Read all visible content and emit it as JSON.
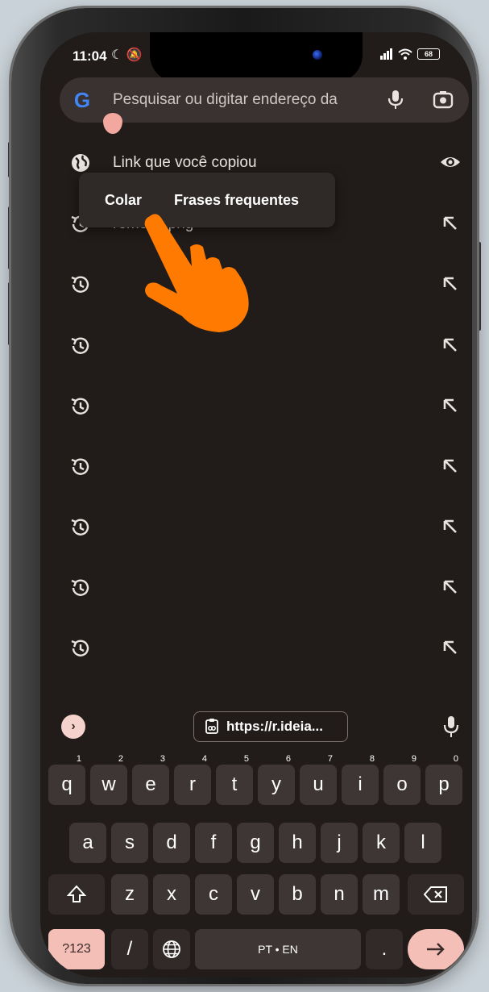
{
  "status_bar": {
    "time": "11:04",
    "battery": "68"
  },
  "search": {
    "placeholder": "Pesquisar ou digitar endereço da"
  },
  "suggestions": [
    {
      "label": "Link que você copiou",
      "type": "clipboard"
    },
    {
      "label": "remove.png",
      "type": "history"
    },
    {
      "label": "",
      "type": "history"
    },
    {
      "label": "",
      "type": "history"
    },
    {
      "label": "",
      "type": "history"
    },
    {
      "label": "",
      "type": "history"
    },
    {
      "label": "",
      "type": "history"
    },
    {
      "label": "",
      "type": "history"
    },
    {
      "label": "",
      "type": "history"
    }
  ],
  "context_menu": {
    "paste": "Colar",
    "frequent": "Frases frequentes"
  },
  "keyboard": {
    "clipboard_chip": "https://r.ideia...",
    "row1": [
      "q",
      "w",
      "e",
      "r",
      "t",
      "y",
      "u",
      "i",
      "o",
      "p"
    ],
    "row1_hints": [
      "1",
      "2",
      "3",
      "4",
      "5",
      "6",
      "7",
      "8",
      "9",
      "0"
    ],
    "row2": [
      "a",
      "s",
      "d",
      "f",
      "g",
      "h",
      "j",
      "k",
      "l"
    ],
    "row3": [
      "z",
      "x",
      "c",
      "v",
      "b",
      "n",
      "m"
    ],
    "symbols_key": "?123",
    "slash_key": "/",
    "space_key": "PT • EN",
    "period_key": "."
  },
  "colors": {
    "screen_bg": "#211c1a",
    "search_bg": "#3a3230",
    "accent_pink": "#f4bfb7",
    "hand_orange": "#ff7a00"
  }
}
